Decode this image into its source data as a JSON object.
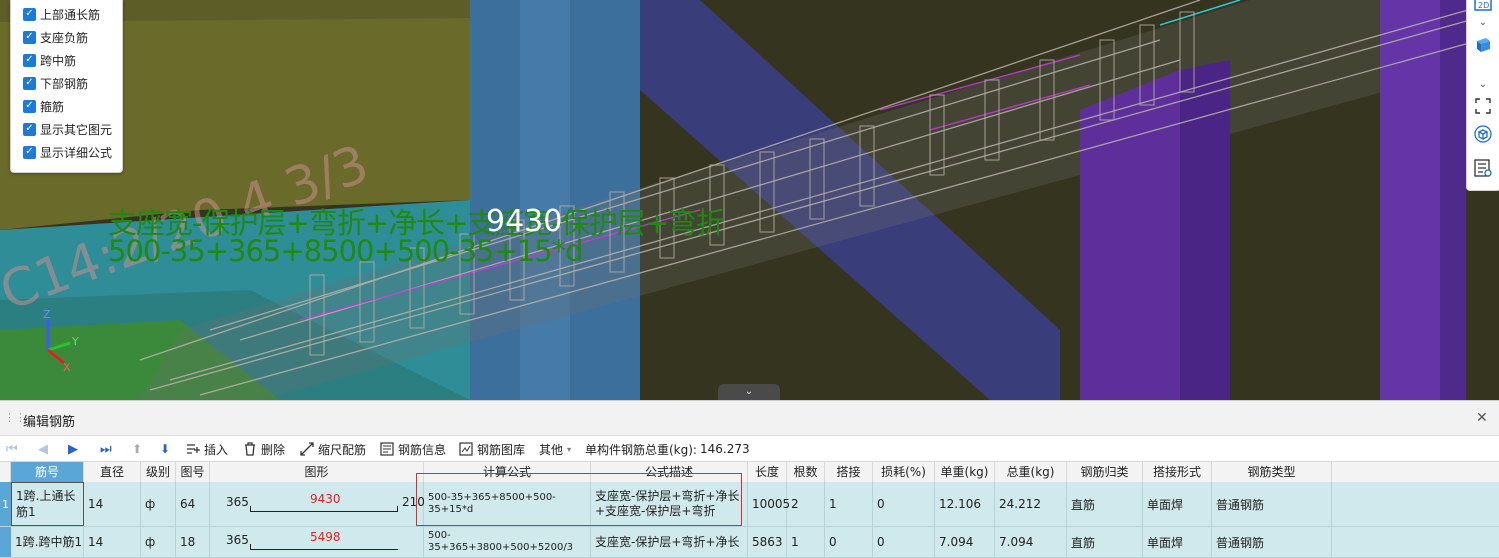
{
  "layers": [
    {
      "label": "上部通长筋",
      "checked": true
    },
    {
      "label": "支座负筋",
      "checked": true
    },
    {
      "label": "跨中筋",
      "checked": true
    },
    {
      "label": "下部钢筋",
      "checked": true
    },
    {
      "label": "箍筋",
      "checked": true
    },
    {
      "label": "显示其它图元",
      "checked": true
    },
    {
      "label": "显示详细公式",
      "checked": true
    }
  ],
  "viewport": {
    "formula_text": "支座宽-保护层+弯折+净长+支座宽-保护层+弯折",
    "formula_values": "500-35+365+8500+500-35+15*d",
    "length_label": "9430",
    "annotation_text": "C14:2/20  4 3/3",
    "axis": {
      "x": "X",
      "y": "Y",
      "z": "Z"
    }
  },
  "right_tools": [
    "view-2d-icon",
    "chevron-down-icon",
    "cube-icon",
    "chevron-down-icon",
    "fullscreen-icon",
    "cube-view-icon",
    "property-list-icon"
  ],
  "editor": {
    "title": "编辑钢筋",
    "toolbar": {
      "insert": "插入",
      "delete": "删除",
      "scale": "缩尺配筋",
      "info": "钢筋信息",
      "library": "钢筋图库",
      "other": "其他",
      "total_weight_label": "单构件钢筋总重(kg):",
      "total_weight_value": "146.273"
    },
    "columns": [
      "筋号",
      "直径(mm)",
      "级别",
      "图号",
      "图形",
      "计算公式",
      "公式描述",
      "长度",
      "根数",
      "搭接",
      "损耗(%)",
      "单重(kg)",
      "总重(kg)",
      "钢筋归类",
      "搭接形式",
      "钢筋类型"
    ],
    "rows": [
      {
        "index": "1",
        "name": "1跨.上通长筋1",
        "diameter": "14",
        "grade": "ф",
        "shape_no": "64",
        "shape_left": "365",
        "shape_mid": "9430",
        "shape_right": "210",
        "formula": "500-35+365+8500+500-35+15*d",
        "description": "支座宽-保护层+弯折+净长+支座宽-保护层+弯折",
        "length": "10005",
        "count": "2",
        "lap": "1",
        "loss": "0",
        "unit_weight": "12.106",
        "total_weight": "24.212",
        "category": "直筋",
        "lap_type": "单面焊",
        "rebar_type": "普通钢筋"
      },
      {
        "index": "",
        "name": "1跨.跨中筋1",
        "diameter": "14",
        "grade": "ф",
        "shape_no": "18",
        "shape_left": "365",
        "shape_mid": "5498",
        "shape_right": "",
        "formula": "500-35+365+3800+500+5200/3",
        "description": "支座宽-保护层+弯折+净长",
        "length": "5863",
        "count": "1",
        "lap": "0",
        "loss": "0",
        "unit_weight": "7.094",
        "total_weight": "7.094",
        "category": "直筋",
        "lap_type": "单面焊",
        "rebar_type": "普通钢筋"
      }
    ]
  }
}
